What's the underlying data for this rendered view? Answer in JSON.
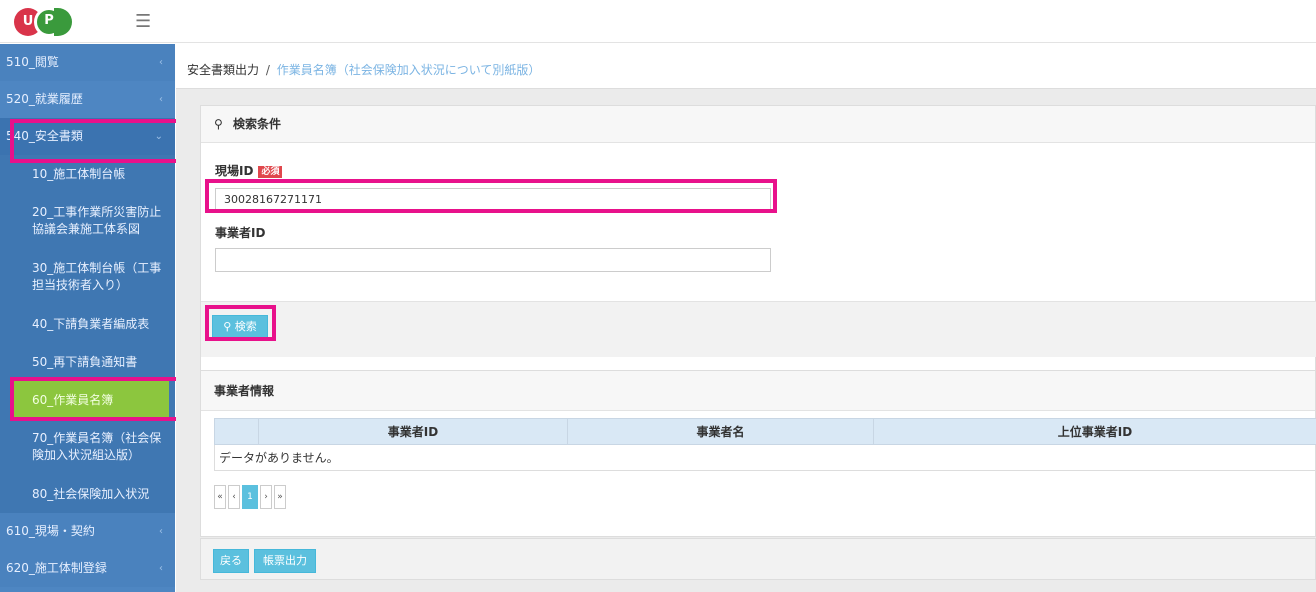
{
  "logo": {
    "letters": [
      "U",
      "P",
      ""
    ]
  },
  "sidebar": {
    "items": [
      {
        "label": "510_閲覧"
      },
      {
        "label": "520_就業履歴"
      },
      {
        "label": "540_安全書類"
      },
      {
        "label": "610_現場・契約"
      },
      {
        "label": "620_施工体制登録"
      }
    ],
    "sub_items": [
      {
        "label": "10_施工体制台帳"
      },
      {
        "label": "20_工事作業所災害防止協議会兼施工体系図"
      },
      {
        "label": "30_施工体制台帳（工事担当技術者入り）"
      },
      {
        "label": "40_下請負業者編成表"
      },
      {
        "label": "50_再下請負通知書"
      },
      {
        "label": "60_作業員名簿"
      },
      {
        "label": "70_作業員名簿（社会保険加入状況組込版）"
      },
      {
        "label": "80_社会保険加入状況"
      }
    ]
  },
  "breadcrumb": {
    "root": "安全書類出力",
    "sep": "/",
    "current": "作業員名簿（社会保険加入状況について別紙版）"
  },
  "search": {
    "title": "検索条件",
    "site_id_label": "現場ID",
    "required_badge": "必須",
    "site_id_value": "30028167271171",
    "company_id_label": "事業者ID",
    "company_id_value": "",
    "search_button": "検索"
  },
  "company_info": {
    "title": "事業者情報",
    "columns": [
      "事業者ID",
      "事業者名",
      "上位事業者ID"
    ],
    "empty_text": "データがありません。",
    "pager": [
      "«",
      "‹",
      "1",
      "›",
      "»"
    ]
  },
  "footer": {
    "back_button": "戻る",
    "output_button": "帳票出力"
  },
  "colors": {
    "highlight": "#e8118b",
    "sidebar": "#4e86c2",
    "active_sub": "#8cc63e",
    "button": "#5bc0de"
  }
}
